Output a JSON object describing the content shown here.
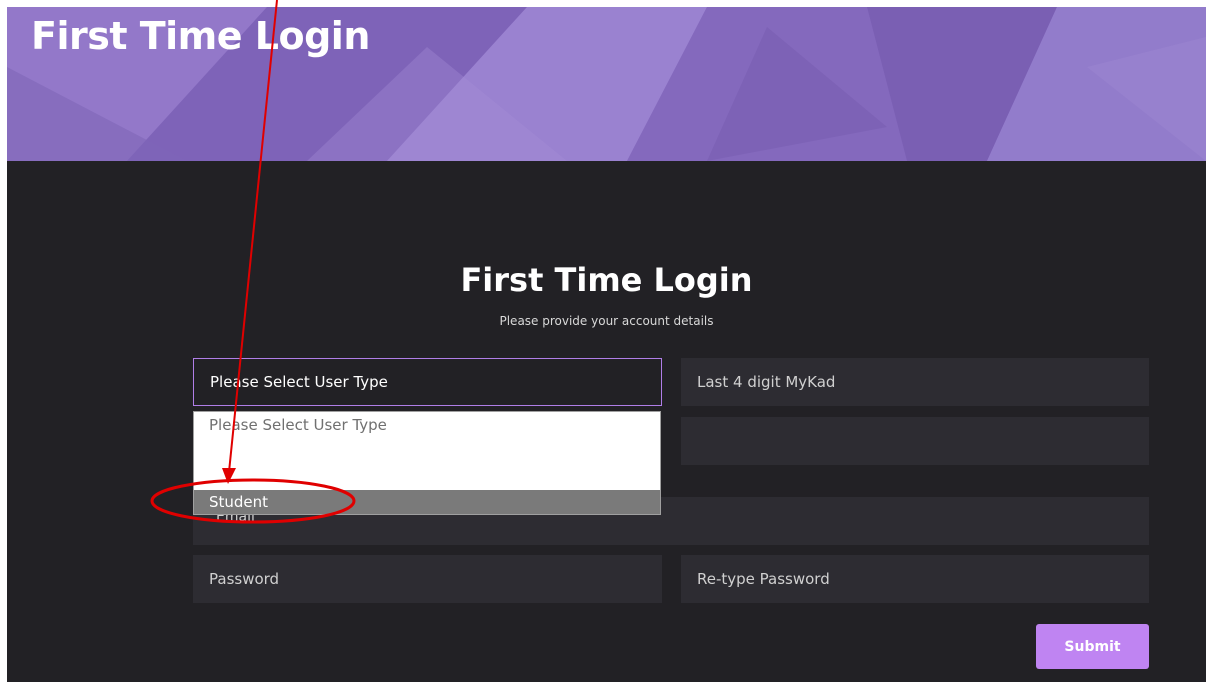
{
  "banner": {
    "title": "First Time Login"
  },
  "form": {
    "title": "First Time Login",
    "subtitle": "Please provide your account details",
    "user_type": {
      "value": "Please Select User Type"
    },
    "mykad": {
      "placeholder": "Last 4 digit MyKad"
    },
    "email": {
      "placeholder": "Email"
    },
    "password": {
      "placeholder": "Password"
    },
    "retype_password": {
      "placeholder": "Re-type Password"
    },
    "submit_label": "Submit"
  },
  "dropdown": {
    "options": [
      "Please Select User Type",
      "Student"
    ],
    "highlighted": "Student"
  },
  "colors": {
    "banner_purple": "#8a6fc2",
    "background": "#222125",
    "field": "#2d2c32",
    "accent": "#bf84f2",
    "annotation_red": "#e00000"
  }
}
